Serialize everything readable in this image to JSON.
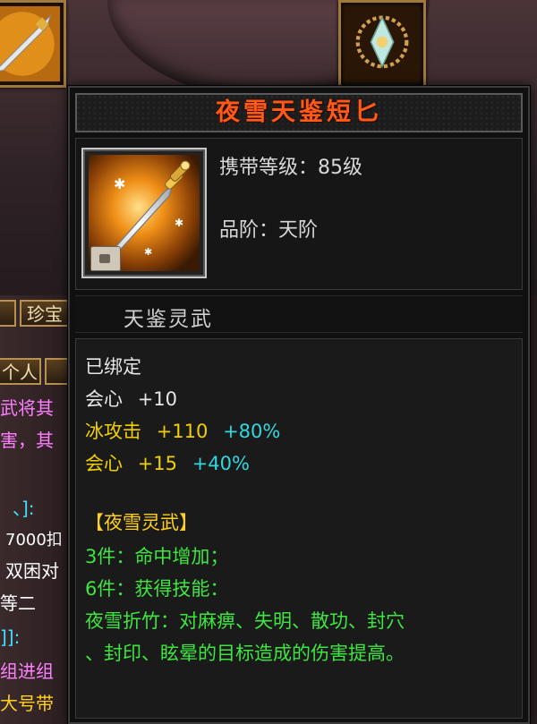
{
  "background": {
    "tab_left": "珍宝",
    "tab_left_small": "个人",
    "side_lines": [
      {
        "text": "武将其",
        "color": "#ff80ff"
      },
      {
        "text": "害，其",
        "color": "#ff80ff"
      },
      {
        "text": "、]:",
        "color": "#40e0ff"
      },
      {
        "text": "7000扣",
        "color": "#ffffff"
      },
      {
        "text": "双困对",
        "color": "#ffffff"
      },
      {
        "text": "等二",
        "color": "#ffffff"
      },
      {
        "text": "]]:",
        "color": "#40e0ff"
      },
      {
        "text": "组进组",
        "color": "#ff80ff"
      },
      {
        "text": "大号带",
        "color": "#ffd020"
      }
    ]
  },
  "item": {
    "name": "夜雪天鉴短匕",
    "level_label": "携带等级：85级",
    "grade_label": "品阶：天阶",
    "category": "天鉴灵武",
    "icon": "dagger-icon",
    "bound_text": "已绑定",
    "base_stat": {
      "name": "会心",
      "value": "+10"
    },
    "attack_stat": {
      "name": "冰攻击",
      "value": "+110",
      "bonus": "+80%"
    },
    "crit_stat": {
      "name": "会心",
      "value": "+15",
      "bonus": "+40%"
    },
    "set_name": "【夜雪灵武】",
    "set_bonus_3": "3件：命中增加；",
    "set_bonus_6": "6件：获得技能：",
    "skill_line_1": "夜雪折竹：对麻痹、失明、散功、封穴",
    "skill_line_2": "、封印、眩晕的目标造成的伤害提高。"
  }
}
